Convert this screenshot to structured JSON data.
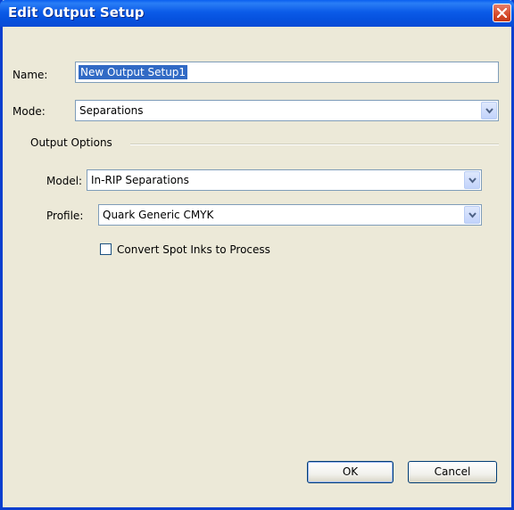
{
  "window": {
    "title": "Edit Output Setup"
  },
  "icons": {
    "close": "close-icon",
    "dropdown": "chevron-down-icon"
  },
  "form": {
    "name_label": "Name:",
    "name_value": "New Output Setup1",
    "mode_label": "Mode:",
    "mode_value": "Separations"
  },
  "output_options": {
    "group_label": "Output Options",
    "model_label": "Model:",
    "model_value": "In-RIP Separations",
    "profile_label": "Profile:",
    "profile_value": "Quark Generic CMYK",
    "convert_spot_label": "Convert Spot Inks to Process",
    "convert_spot_checked": false
  },
  "buttons": {
    "ok": "OK",
    "cancel": "Cancel"
  },
  "colors": {
    "titlebar": "#0a5ff0",
    "dialog_bg": "#ece9d8",
    "selection": "#316ac5"
  }
}
